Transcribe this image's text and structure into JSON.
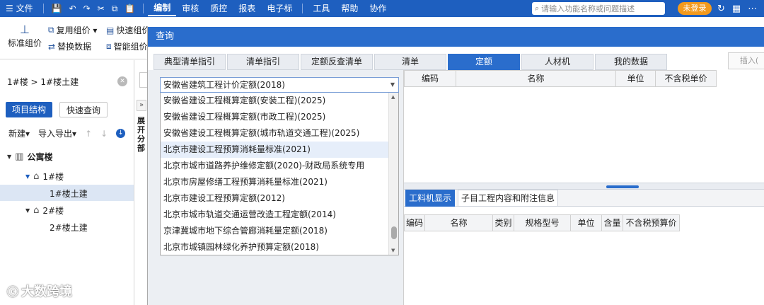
{
  "menubar": {
    "file": "☰ 文件",
    "quick_icons": [
      "💾",
      "↶",
      "↷",
      "✂",
      "⧉",
      "📋"
    ],
    "menus": [
      "编制",
      "审核",
      "质控",
      "报表",
      "电子标",
      "工具",
      "帮助",
      "协作"
    ],
    "active_menu": "编制",
    "search_placeholder": "请输入功能名称或问题描述",
    "login": "未登录"
  },
  "toolbar": {
    "std_price": "标准组价",
    "reuse": "复用组价 ▾",
    "replace": "替换数据",
    "quick": "快速组价",
    "smart": "智能组价"
  },
  "left_panel": {
    "breadcrumb": "1#楼 > 1#楼土建",
    "tab_structure": "项目结构",
    "tab_quick": "快速查询",
    "new": "新建▾",
    "import_export": "导入导出▾",
    "tree": {
      "root": "公寓楼",
      "b1": "1#楼",
      "b1_civil": "1#楼土建",
      "b2": "2#楼",
      "b2_civil": "2#楼土建"
    }
  },
  "middle_strip": {
    "vertical_text": "展开分部"
  },
  "dialog": {
    "title": "查询",
    "tabs": [
      "典型清单指引",
      "清单指引",
      "定额反查清单",
      "清单",
      "定额",
      "人材机",
      "我的数据"
    ],
    "active_tab": "定额",
    "insert_button": "插入(",
    "selected_quota": "安徽省建筑工程计价定额(2018)",
    "dropdown_options": [
      "安徽省建设工程概算定额(安装工程)(2025)",
      "安徽省建设工程概算定额(市政工程)(2025)",
      "安徽省建设工程概算定额(城市轨道交通工程)(2025)",
      "北京市建设工程预算消耗量标准(2021)",
      "北京市城市道路养护维修定额(2020)-财政局系统专用",
      "北京市房屋修缮工程预算消耗量标准(2021)",
      "北京市建设工程预算定额(2012)",
      "北京市城市轨道交通运营改造工程定额(2014)",
      "京津冀城市地下综合管廊消耗量定额(2018)",
      "北京市城镇园林绿化养护预算定额(2018)"
    ],
    "highlighted_option_index": 3,
    "top_grid_headers": [
      "编码",
      "名称",
      "单位",
      "不含税单价"
    ],
    "bottom_tabs": [
      "工料机显示",
      "子目工程内容和附注信息"
    ],
    "active_bottom_tab": "工料机显示",
    "bottom_grid_headers": [
      "编码",
      "名称",
      "类别",
      "规格型号",
      "单位",
      "含量",
      "不含税预算价"
    ]
  },
  "watermark": "大数跨境",
  "colors": {
    "brand_blue": "#1e5fbf",
    "dialog_blue": "#2a6dcc",
    "login_orange": "#f39a1e"
  }
}
